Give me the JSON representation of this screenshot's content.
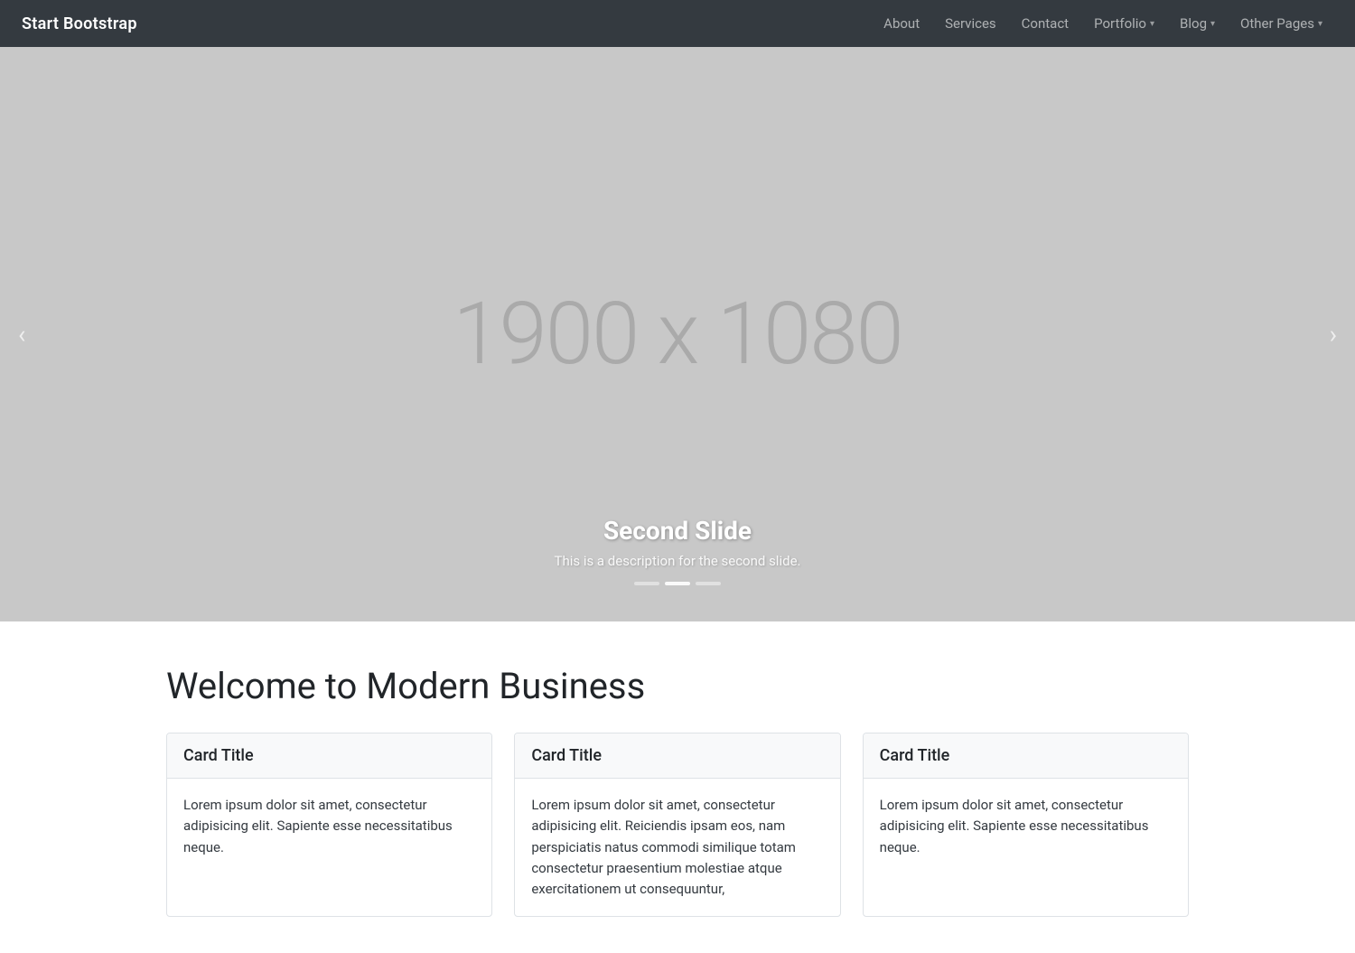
{
  "navbar": {
    "brand": "Start Bootstrap",
    "links": [
      {
        "label": "About",
        "dropdown": false
      },
      {
        "label": "Services",
        "dropdown": false
      },
      {
        "label": "Contact",
        "dropdown": false
      },
      {
        "label": "Portfolio",
        "dropdown": true
      },
      {
        "label": "Blog",
        "dropdown": true
      },
      {
        "label": "Other Pages",
        "dropdown": true
      }
    ]
  },
  "carousel": {
    "placeholder": "1900 x 1080",
    "prev_label": "‹",
    "next_label": "›",
    "slide_title": "Second Slide",
    "slide_desc": "This is a description for the second slide.",
    "indicators": [
      {
        "active": false
      },
      {
        "active": true
      },
      {
        "active": false
      }
    ]
  },
  "main": {
    "title": "Welcome to Modern Business",
    "cards": [
      {
        "title": "Card Title",
        "body": "Lorem ipsum dolor sit amet, consectetur adipisicing elit. Sapiente esse necessitatibus neque."
      },
      {
        "title": "Card Title",
        "body": "Lorem ipsum dolor sit amet, consectetur adipisicing elit. Reiciendis ipsam eos, nam perspiciatis natus commodi similique totam consectetur praesentium molestiae atque exercitationem ut consequuntur,"
      },
      {
        "title": "Card Title",
        "body": "Lorem ipsum dolor sit amet, consectetur adipisicing elit. Sapiente esse necessitatibus neque."
      }
    ]
  }
}
